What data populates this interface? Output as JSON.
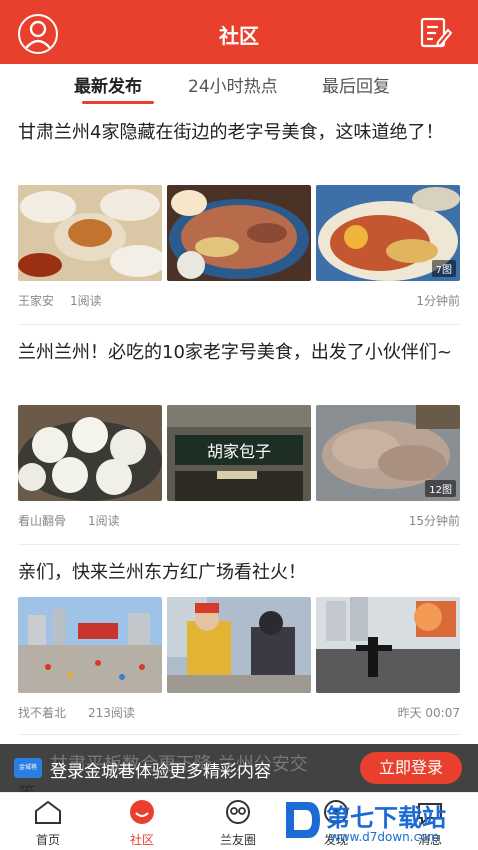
{
  "header": {
    "title": "社区",
    "user_icon": "user-icon",
    "edit_icon": "edit-icon"
  },
  "tabs": [
    {
      "label": "最新发布",
      "active": true
    },
    {
      "label": "24小时热点",
      "active": false
    },
    {
      "label": "最后回复",
      "active": false
    }
  ],
  "posts": [
    {
      "title": "甘肃兰州4家隐藏在街边的老字号美食，这味道绝了！",
      "author": "王家安",
      "reads": "1阅读",
      "time": "1分钟前",
      "image_count": "7图"
    },
    {
      "title": "兰州兰州！必吃的10家老字号美食，出发了小伙伴们~",
      "author": "看山翻骨",
      "reads": "1阅读",
      "time": "15分钟前",
      "image_count": "12图"
    },
    {
      "title": "亲们，快来兰州东方红广场看社火！",
      "author": "找不着北",
      "reads": "213阅读",
      "time": "昨天 00:07",
      "image_count": ""
    }
  ],
  "thumb_signs": {
    "post2_shop_sign": "胡家包子"
  },
  "login_banner": {
    "message": "登录金城巷体验更多精彩内容",
    "button": "立即登录",
    "peek_text": "甘肃平板数合更下降 兰州公安交",
    "peek_line2": "等"
  },
  "tabbar": [
    {
      "label": "首页",
      "icon": "home-icon",
      "active": false
    },
    {
      "label": "社区",
      "icon": "community-icon",
      "active": true
    },
    {
      "label": "兰友圈",
      "icon": "friends-circle-icon",
      "active": false
    },
    {
      "label": "发现",
      "icon": "discover-icon",
      "active": false
    },
    {
      "label": "消息",
      "icon": "message-icon",
      "active": false
    }
  ],
  "watermark": {
    "title": "第七下载站",
    "url": "www.d7down.com"
  },
  "colors": {
    "brand": "#e8402c",
    "watermark": "#1b6bd6"
  }
}
